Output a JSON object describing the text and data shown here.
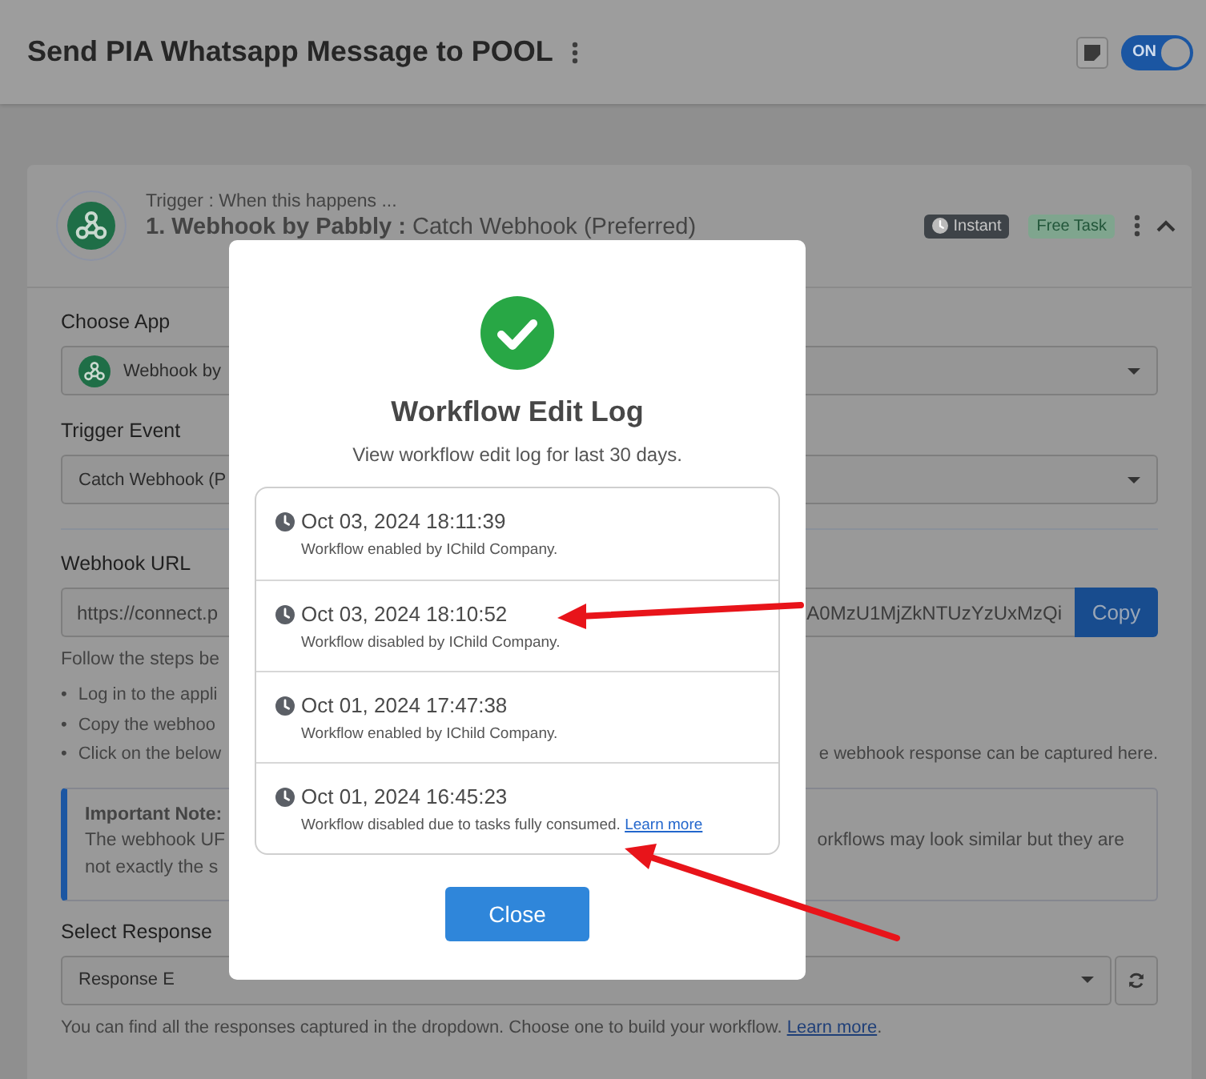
{
  "header": {
    "title": "Send PIA Whatsapp Message to POOL",
    "toggle": {
      "label": "ON",
      "on": true
    }
  },
  "trigger": {
    "caption": "Trigger : When this happens ...",
    "title": "**1. Webhook by Pabbly :** Catch Webhook (Preferred)",
    "badges": [
      {
        "label": "Instant",
        "kind": "instant"
      },
      {
        "label": "Free Task",
        "kind": "free"
      }
    ],
    "expanded": true
  },
  "form": {
    "choose_app": {
      "label": "Choose App",
      "value": "Webhook by"
    },
    "trigger_event": {
      "label": "Trigger Event",
      "value": "Catch Webhook (P"
    },
    "webhook_url": {
      "label": "Webhook URL",
      "value_left": "https://connect.p",
      "value_right": "A0MzU1MjZkNTUzYzUxMzQi",
      "button": "Copy"
    },
    "instructions": "Follow the steps be",
    "steps": [
      {
        "marker": "•",
        "left": "Log in to the appli"
      },
      {
        "marker": "•",
        "left": "Copy the webhoo"
      },
      {
        "marker": "•",
        "left": "Click on the below",
        "right": "e webhook response can be captured here."
      }
    ],
    "note": {
      "title": "Important Note:",
      "lines": [
        {
          "left": "The webhook UF",
          "right": "orkflows may look similar but they are"
        },
        {
          "left": "not exactly the s"
        }
      ]
    },
    "select_response": {
      "label": "Select Response",
      "value": "Response E",
      "help": "You can find all the responses captured in the dropdown. Choose one to build your workflow.",
      "link": "Learn more",
      "after": "."
    }
  },
  "modal": {
    "title": "Workflow Edit Log",
    "subtitle": "View workflow edit log for last 30 days.",
    "entries": [
      {
        "time": "Oct 03, 2024 18:11:39",
        "description": "Workflow enabled by IChild Company."
      },
      {
        "time": "Oct 03, 2024 18:10:52",
        "description": "Workflow disabled by IChild Company."
      },
      {
        "time": "Oct 01, 2024 17:47:38",
        "description": "Workflow enabled by IChild Company."
      },
      {
        "time": "Oct 01, 2024 16:45:23",
        "description": "Workflow disabled due to tasks fully consumed.",
        "link": "Learn more"
      }
    ],
    "button": "Close"
  }
}
